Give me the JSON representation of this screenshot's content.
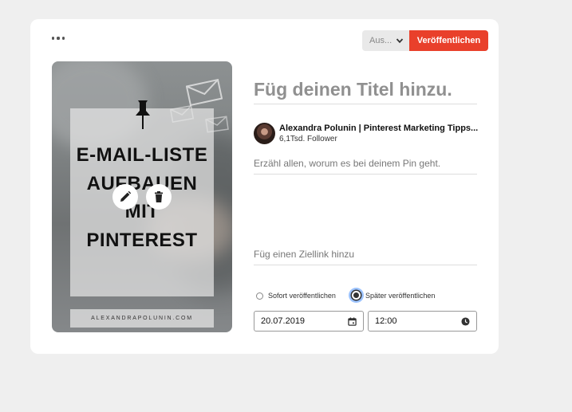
{
  "toolbar": {
    "board_select": "Aus...",
    "publish_label": "Veröffentlichen"
  },
  "pin_image": {
    "title_lines": [
      "E-MAIL-LISTE",
      "AUFBAUEN",
      "MIT",
      "PINTEREST"
    ],
    "footer": "ALEXANDRAPOLUNIN.COM"
  },
  "form": {
    "title_placeholder": "Füg deinen Titel hinzu.",
    "profile_name": "Alexandra Polunin | Pinterest Marketing Tipps...",
    "followers": "6,1Tsd. Follower",
    "description_placeholder": "Erzähl allen, worum es bei deinem Pin geht.",
    "link_placeholder": "Füg einen Ziellink hinzu",
    "publish_options": [
      {
        "label": "Sofort veröffentlichen",
        "selected": false
      },
      {
        "label": "Später veröffentlichen",
        "selected": true
      }
    ],
    "date": "20.07.2019",
    "time": "12:00"
  },
  "colors": {
    "accent": "#e9402b",
    "background": "#efefef",
    "card": "#ffffff"
  },
  "icons": [
    "more-icon",
    "chevron-down-icon",
    "pushpin-icon",
    "envelope-icon",
    "pencil-icon",
    "trash-icon",
    "calendar-icon",
    "clock-icon"
  ]
}
